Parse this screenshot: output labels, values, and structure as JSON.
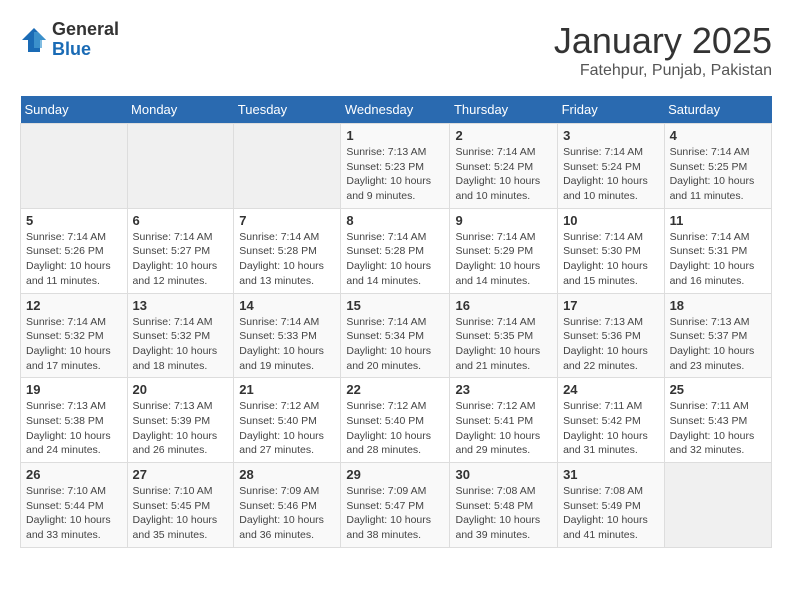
{
  "logo": {
    "general": "General",
    "blue": "Blue"
  },
  "header": {
    "title": "January 2025",
    "subtitle": "Fatehpur, Punjab, Pakistan"
  },
  "weekdays": [
    "Sunday",
    "Monday",
    "Tuesday",
    "Wednesday",
    "Thursday",
    "Friday",
    "Saturday"
  ],
  "weeks": [
    [
      {
        "day": "",
        "info": ""
      },
      {
        "day": "",
        "info": ""
      },
      {
        "day": "",
        "info": ""
      },
      {
        "day": "1",
        "info": "Sunrise: 7:13 AM\nSunset: 5:23 PM\nDaylight: 10 hours\nand 9 minutes."
      },
      {
        "day": "2",
        "info": "Sunrise: 7:14 AM\nSunset: 5:24 PM\nDaylight: 10 hours\nand 10 minutes."
      },
      {
        "day": "3",
        "info": "Sunrise: 7:14 AM\nSunset: 5:24 PM\nDaylight: 10 hours\nand 10 minutes."
      },
      {
        "day": "4",
        "info": "Sunrise: 7:14 AM\nSunset: 5:25 PM\nDaylight: 10 hours\nand 11 minutes."
      }
    ],
    [
      {
        "day": "5",
        "info": "Sunrise: 7:14 AM\nSunset: 5:26 PM\nDaylight: 10 hours\nand 11 minutes."
      },
      {
        "day": "6",
        "info": "Sunrise: 7:14 AM\nSunset: 5:27 PM\nDaylight: 10 hours\nand 12 minutes."
      },
      {
        "day": "7",
        "info": "Sunrise: 7:14 AM\nSunset: 5:28 PM\nDaylight: 10 hours\nand 13 minutes."
      },
      {
        "day": "8",
        "info": "Sunrise: 7:14 AM\nSunset: 5:28 PM\nDaylight: 10 hours\nand 14 minutes."
      },
      {
        "day": "9",
        "info": "Sunrise: 7:14 AM\nSunset: 5:29 PM\nDaylight: 10 hours\nand 14 minutes."
      },
      {
        "day": "10",
        "info": "Sunrise: 7:14 AM\nSunset: 5:30 PM\nDaylight: 10 hours\nand 15 minutes."
      },
      {
        "day": "11",
        "info": "Sunrise: 7:14 AM\nSunset: 5:31 PM\nDaylight: 10 hours\nand 16 minutes."
      }
    ],
    [
      {
        "day": "12",
        "info": "Sunrise: 7:14 AM\nSunset: 5:32 PM\nDaylight: 10 hours\nand 17 minutes."
      },
      {
        "day": "13",
        "info": "Sunrise: 7:14 AM\nSunset: 5:32 PM\nDaylight: 10 hours\nand 18 minutes."
      },
      {
        "day": "14",
        "info": "Sunrise: 7:14 AM\nSunset: 5:33 PM\nDaylight: 10 hours\nand 19 minutes."
      },
      {
        "day": "15",
        "info": "Sunrise: 7:14 AM\nSunset: 5:34 PM\nDaylight: 10 hours\nand 20 minutes."
      },
      {
        "day": "16",
        "info": "Sunrise: 7:14 AM\nSunset: 5:35 PM\nDaylight: 10 hours\nand 21 minutes."
      },
      {
        "day": "17",
        "info": "Sunrise: 7:13 AM\nSunset: 5:36 PM\nDaylight: 10 hours\nand 22 minutes."
      },
      {
        "day": "18",
        "info": "Sunrise: 7:13 AM\nSunset: 5:37 PM\nDaylight: 10 hours\nand 23 minutes."
      }
    ],
    [
      {
        "day": "19",
        "info": "Sunrise: 7:13 AM\nSunset: 5:38 PM\nDaylight: 10 hours\nand 24 minutes."
      },
      {
        "day": "20",
        "info": "Sunrise: 7:13 AM\nSunset: 5:39 PM\nDaylight: 10 hours\nand 26 minutes."
      },
      {
        "day": "21",
        "info": "Sunrise: 7:12 AM\nSunset: 5:40 PM\nDaylight: 10 hours\nand 27 minutes."
      },
      {
        "day": "22",
        "info": "Sunrise: 7:12 AM\nSunset: 5:40 PM\nDaylight: 10 hours\nand 28 minutes."
      },
      {
        "day": "23",
        "info": "Sunrise: 7:12 AM\nSunset: 5:41 PM\nDaylight: 10 hours\nand 29 minutes."
      },
      {
        "day": "24",
        "info": "Sunrise: 7:11 AM\nSunset: 5:42 PM\nDaylight: 10 hours\nand 31 minutes."
      },
      {
        "day": "25",
        "info": "Sunrise: 7:11 AM\nSunset: 5:43 PM\nDaylight: 10 hours\nand 32 minutes."
      }
    ],
    [
      {
        "day": "26",
        "info": "Sunrise: 7:10 AM\nSunset: 5:44 PM\nDaylight: 10 hours\nand 33 minutes."
      },
      {
        "day": "27",
        "info": "Sunrise: 7:10 AM\nSunset: 5:45 PM\nDaylight: 10 hours\nand 35 minutes."
      },
      {
        "day": "28",
        "info": "Sunrise: 7:09 AM\nSunset: 5:46 PM\nDaylight: 10 hours\nand 36 minutes."
      },
      {
        "day": "29",
        "info": "Sunrise: 7:09 AM\nSunset: 5:47 PM\nDaylight: 10 hours\nand 38 minutes."
      },
      {
        "day": "30",
        "info": "Sunrise: 7:08 AM\nSunset: 5:48 PM\nDaylight: 10 hours\nand 39 minutes."
      },
      {
        "day": "31",
        "info": "Sunrise: 7:08 AM\nSunset: 5:49 PM\nDaylight: 10 hours\nand 41 minutes."
      },
      {
        "day": "",
        "info": ""
      }
    ]
  ]
}
